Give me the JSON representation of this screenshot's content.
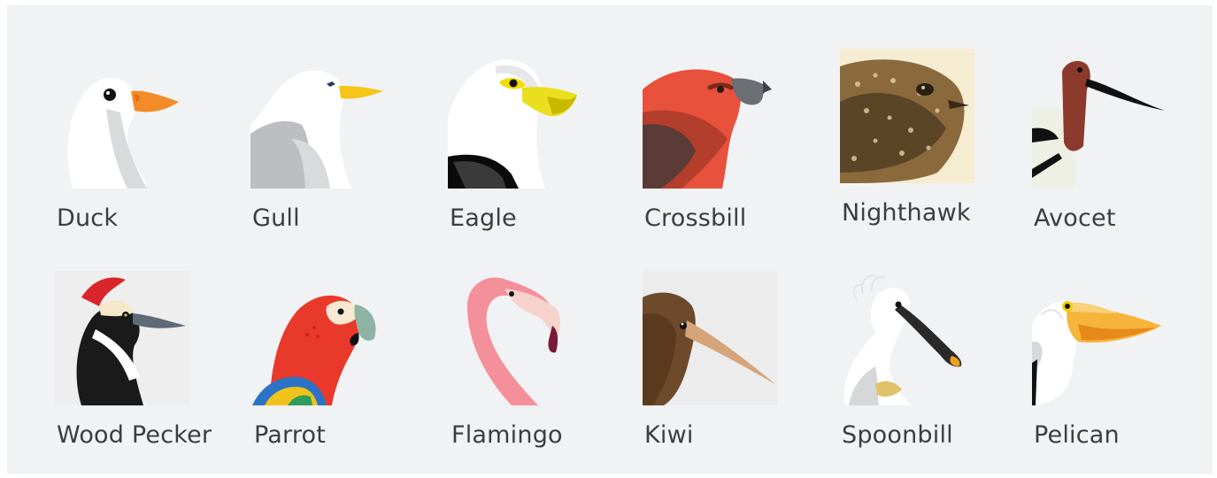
{
  "gallery": {
    "birds": [
      {
        "name": "Duck",
        "icon": "duck-icon"
      },
      {
        "name": "Gull",
        "icon": "gull-icon"
      },
      {
        "name": "Eagle",
        "icon": "eagle-icon"
      },
      {
        "name": "Crossbill",
        "icon": "crossbill-icon"
      },
      {
        "name": "Nighthawk",
        "icon": "nighthawk-icon"
      },
      {
        "name": "Avocet",
        "icon": "avocet-icon"
      },
      {
        "name": "Wood Pecker",
        "icon": "woodpecker-icon"
      },
      {
        "name": "Parrot",
        "icon": "parrot-icon"
      },
      {
        "name": "Flamingo",
        "icon": "flamingo-icon"
      },
      {
        "name": "Kiwi",
        "icon": "kiwi-icon"
      },
      {
        "name": "Spoonbill",
        "icon": "spoonbill-icon"
      },
      {
        "name": "Pelican",
        "icon": "pelican-icon"
      }
    ]
  },
  "colors": {
    "background": "#f1f2f4",
    "label": "#3d3d3d"
  }
}
